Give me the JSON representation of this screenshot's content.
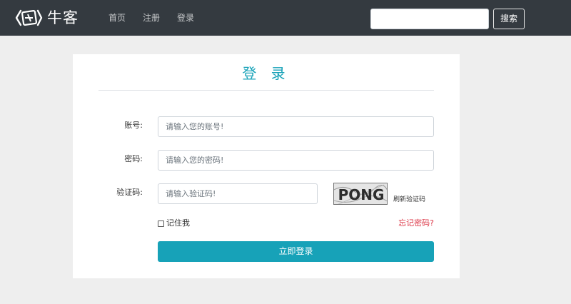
{
  "navbar": {
    "brand": "牛客",
    "links": [
      "首页",
      "注册",
      "登录"
    ],
    "search_button": "搜索",
    "search_placeholder": ""
  },
  "form": {
    "title": "登 录",
    "username_label": "账号:",
    "username_placeholder": "请输入您的账号!",
    "password_label": "密码:",
    "password_placeholder": "请输入您的密码!",
    "captcha_label": "验证码:",
    "captcha_placeholder": "请输入验证码!",
    "captcha_text": "PONG",
    "refresh_label": "刷新验证码",
    "remember_label": "记住我",
    "forgot_label": "忘记密码?",
    "submit_label": "立即登录"
  },
  "colors": {
    "navbar": "#343a40",
    "accent": "#17a2b8",
    "danger": "#dc3545",
    "page_background": "#eeeeee"
  }
}
